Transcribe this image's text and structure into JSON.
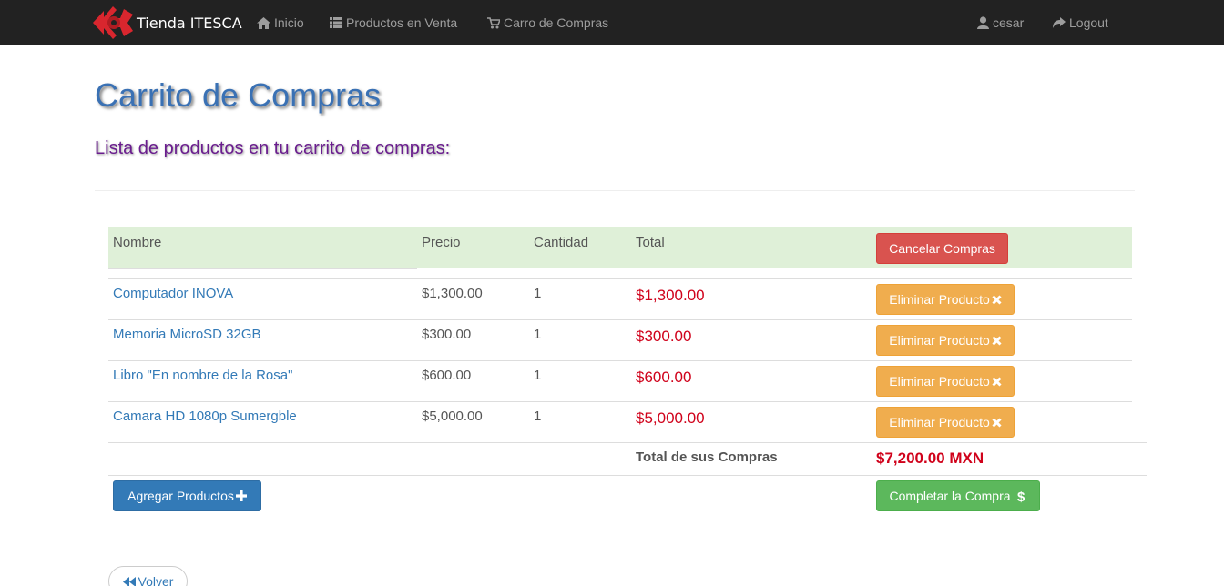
{
  "navbar": {
    "brand": "Tienda ITESCA",
    "items": [
      {
        "label": "Inicio",
        "icon": "home-icon"
      },
      {
        "label": "Productos en Venta",
        "icon": "list-icon"
      },
      {
        "label": "Carro de Compras",
        "icon": "cart-icon"
      }
    ],
    "user": {
      "label": "cesar",
      "icon": "user-icon"
    },
    "logout": {
      "label": "Logout",
      "icon": "share-icon"
    }
  },
  "page": {
    "title": "Carrito de Compras",
    "subtitle": "Lista de productos en tu carrito de compras:"
  },
  "table": {
    "headers": [
      "Nombre",
      "Precio",
      "Cantidad",
      "Total"
    ],
    "cancel_label": "Cancelar Compras",
    "remove_label": "Eliminar Producto",
    "rows": [
      {
        "name": "Computador INOVA",
        "price": "$1,300.00",
        "qty": "1",
        "total": "$1,300.00"
      },
      {
        "name": "Memoria MicroSD 32GB",
        "price": "$300.00",
        "qty": "1",
        "total": "$300.00"
      },
      {
        "name": "Libro \"En nombre de la Rosa\"",
        "price": "$600.00",
        "qty": "1",
        "total": "$600.00"
      },
      {
        "name": "Camara HD 1080p Sumergble",
        "price": "$5,000.00",
        "qty": "1",
        "total": "$5,000.00"
      }
    ],
    "total_label": "Total de sus Compras",
    "total_value": "$7,200.00 MXN"
  },
  "actions": {
    "add_label": "Agregar Productos",
    "complete_label": "Completar la Compra",
    "back_label": "Volver"
  },
  "colors": {
    "navbar": "#222222",
    "header_row": "#dff0d8",
    "title": "#3a71b4",
    "subtitle": "#6a1d8e",
    "total_red": "#d0021b"
  }
}
